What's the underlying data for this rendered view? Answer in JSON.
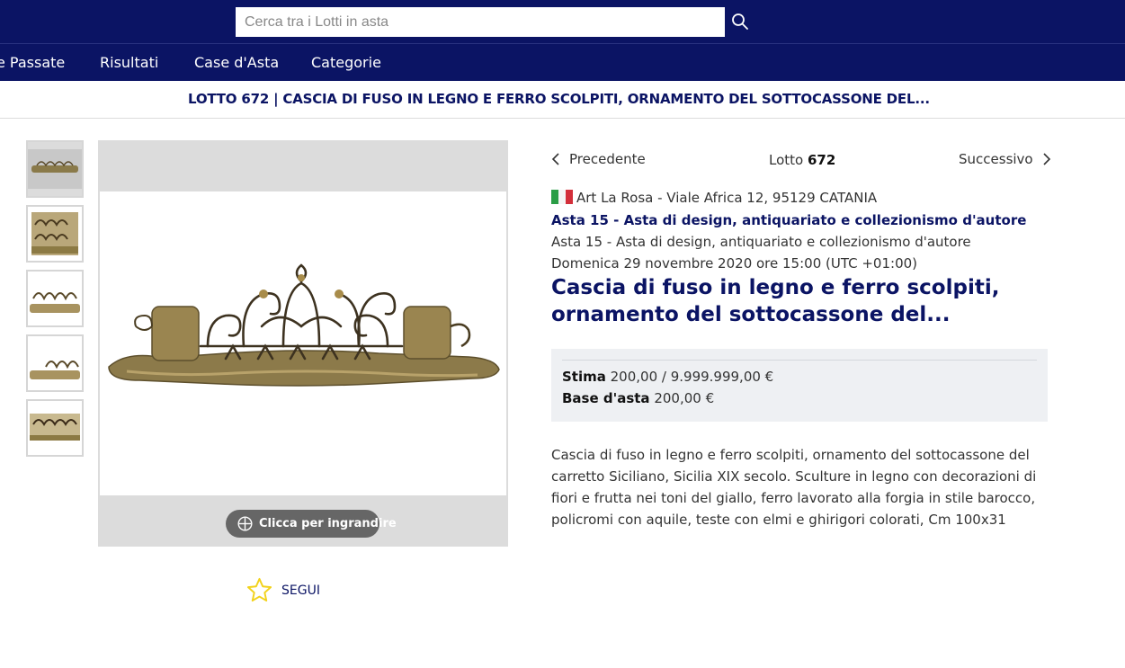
{
  "search": {
    "placeholder": "Cerca tra i Lotti in asta"
  },
  "nav": {
    "items": [
      {
        "label": "e Passate"
      },
      {
        "label": "Risultati"
      },
      {
        "label": "Case d'Asta"
      },
      {
        "label": "Categorie"
      }
    ]
  },
  "title_bar": {
    "text": "LOTTO 672 | CASCIA DI FUSO IN LEGNO E FERRO SCOLPITI, ORNAMENTO DEL SOTTOCASSONE DEL..."
  },
  "viewer": {
    "zoom_label": "Clicca per ingrandire",
    "thumbnail_count": 5
  },
  "follow": {
    "label": "SEGUI"
  },
  "lot_nav": {
    "prev": "Precedente",
    "next": "Successivo",
    "lot_prefix": "Lotto",
    "lot_number": "672"
  },
  "auction_house": {
    "text": "Art La Rosa - Viale Africa 12, 95129 CATANIA",
    "flag_colors": [
      "#2a9d46",
      "#ffffff",
      "#d32f3a"
    ]
  },
  "sale": {
    "name_bold": "Asta 15 - Asta di design, antiquariato e collezionismo d'autore",
    "name_plain": " Asta 15 - Asta di design, antiquariato e collezionismo d'autore",
    "date": "Domenica 29 novembre 2020 ore 15:00 (UTC +01:00)"
  },
  "lot": {
    "title": "Cascia di fuso in legno e ferro scolpiti, ornamento del sottocassone del...",
    "estimate_label": "Stima",
    "estimate_value": " 200,00 / 9.999.999,00 €",
    "base_label": "Base d'asta",
    "base_value": " 200,00 €",
    "description": "Cascia di fuso in legno e ferro scolpiti, ornamento del sottocassone del carretto Siciliano, Sicilia XIX secolo. Sculture in legno con decorazioni di fiori e frutta nei toni del giallo, ferro lavorato alla forgia in stile barocco, policromi con aquile, teste con elmi e ghirigori colorati, Cm 100x31"
  },
  "colors": {
    "brand": "#0b1464",
    "accent_star": "#f2d21b"
  }
}
